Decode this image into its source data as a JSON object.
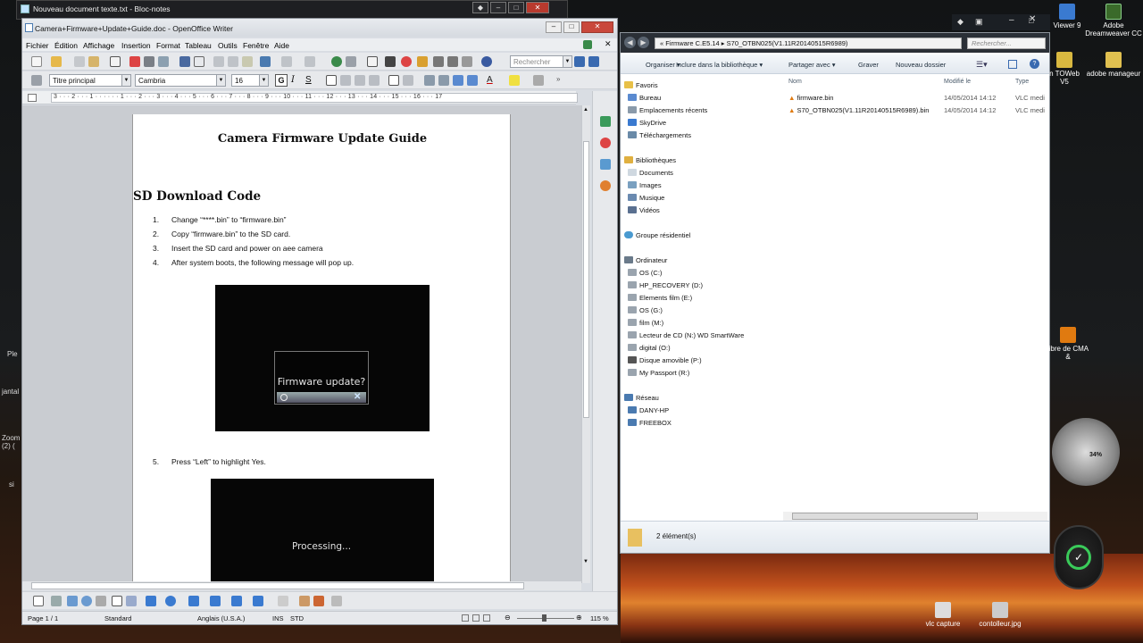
{
  "notepad": {
    "title": "Nouveau document texte.txt - Bloc-notes"
  },
  "writer": {
    "title": "Camera+Firmware+Update+Guide.doc - OpenOffice Writer",
    "menus": [
      "Fichier",
      "Édition",
      "Affichage",
      "Insertion",
      "Format",
      "Tableau",
      "Outils",
      "Fenêtre",
      "Aide"
    ],
    "search_placeholder": "Rechercher",
    "style_value": "Titre principal",
    "font_value": "Cambria",
    "size_value": "16",
    "ruler_text": "3 · · · 2 · · · 1 · · · · · · 1 · · · 2 · · · 3 · · · 4 · · · 5 · · · 6 · · · 7 · · · 8 · · · 9 · · · 10 · · · 11 · · · 12 · · · 13 · · · 14 · · · 15 · · · 16 · · · 17",
    "doc": {
      "title": "Camera Firmware Update Guide",
      "section": "SD Download Code",
      "steps": [
        {
          "n": "1.",
          "text": "Change “****.bin” to “firmware.bin”"
        },
        {
          "n": "2.",
          "text": "Copy “firmware.bin” to the SD card."
        },
        {
          "n": "3.",
          "text": "Insert the SD card and power on aee camera"
        },
        {
          "n": "4.",
          "text": "After system boots, the following message will pop up."
        },
        {
          "n": "5.",
          "text": "Press “Left” to highlight Yes."
        }
      ],
      "dialog_text": "Firmware update?",
      "processing_text": "Processing..."
    },
    "status": {
      "page": "Page 1 / 1",
      "style": "Standard",
      "lang": "Anglais (U.S.A.)",
      "ins": "INS",
      "std": "STD",
      "zoom": "115 %"
    }
  },
  "explorer": {
    "path_root": "Firmware C.E5.14",
    "path_leaf": "S70_OTBN025(V1.11R20140515R6989)",
    "search_placeholder": "Rechercher...",
    "commands": [
      "Organiser ▾",
      "Inclure dans la bibliothèque ▾",
      "Partager avec ▾",
      "Graver",
      "Nouveau dossier"
    ],
    "nav": {
      "favorites": "Favoris",
      "fav_items": [
        "Bureau",
        "Emplacements récents",
        "SkyDrive",
        "Téléchargements"
      ],
      "libraries": "Bibliothèques",
      "lib_items": [
        "Documents",
        "Images",
        "Musique",
        "Vidéos"
      ],
      "homegroup": "Groupe résidentiel",
      "computer": "Ordinateur",
      "drives": [
        "OS (C:)",
        "HP_RECOVERY (D:)",
        "Elements film (E:)",
        "OS (G:)",
        "film (M:)",
        "Lecteur de CD (N:) WD SmartWare",
        "digital (O:)",
        "Disque amovible (P:)",
        "My Passport (R:)"
      ],
      "network": "Réseau",
      "net_items": [
        "DANY-HP",
        "FREEBOX"
      ]
    },
    "columns": {
      "name": "Nom",
      "modified": "Modifié le",
      "type": "Type"
    },
    "files": [
      {
        "name": "firmware.bin",
        "modified": "14/05/2014 14:12",
        "type": "VLC medi"
      },
      {
        "name": "S70_OTBN025(V1.11R20140515R6989).bin",
        "modified": "14/05/2014 14:12",
        "type": "VLC medi"
      }
    ],
    "status": "2 élément(s)"
  },
  "desktop": {
    "icons": [
      {
        "label": "Viewer 9"
      },
      {
        "label": "Adobe Dreamweaver CC"
      },
      {
        "label": "n TOWeb V5"
      },
      {
        "label": "adobe manageur"
      },
      {
        "label": "libre de CMA &"
      },
      {
        "label": "vlc capture"
      },
      {
        "label": "contolleur.jpg"
      }
    ],
    "left_labels": [
      "Ple",
      "jantal",
      "Zoom (2) (",
      "si"
    ],
    "gadget_percent": "34%"
  }
}
